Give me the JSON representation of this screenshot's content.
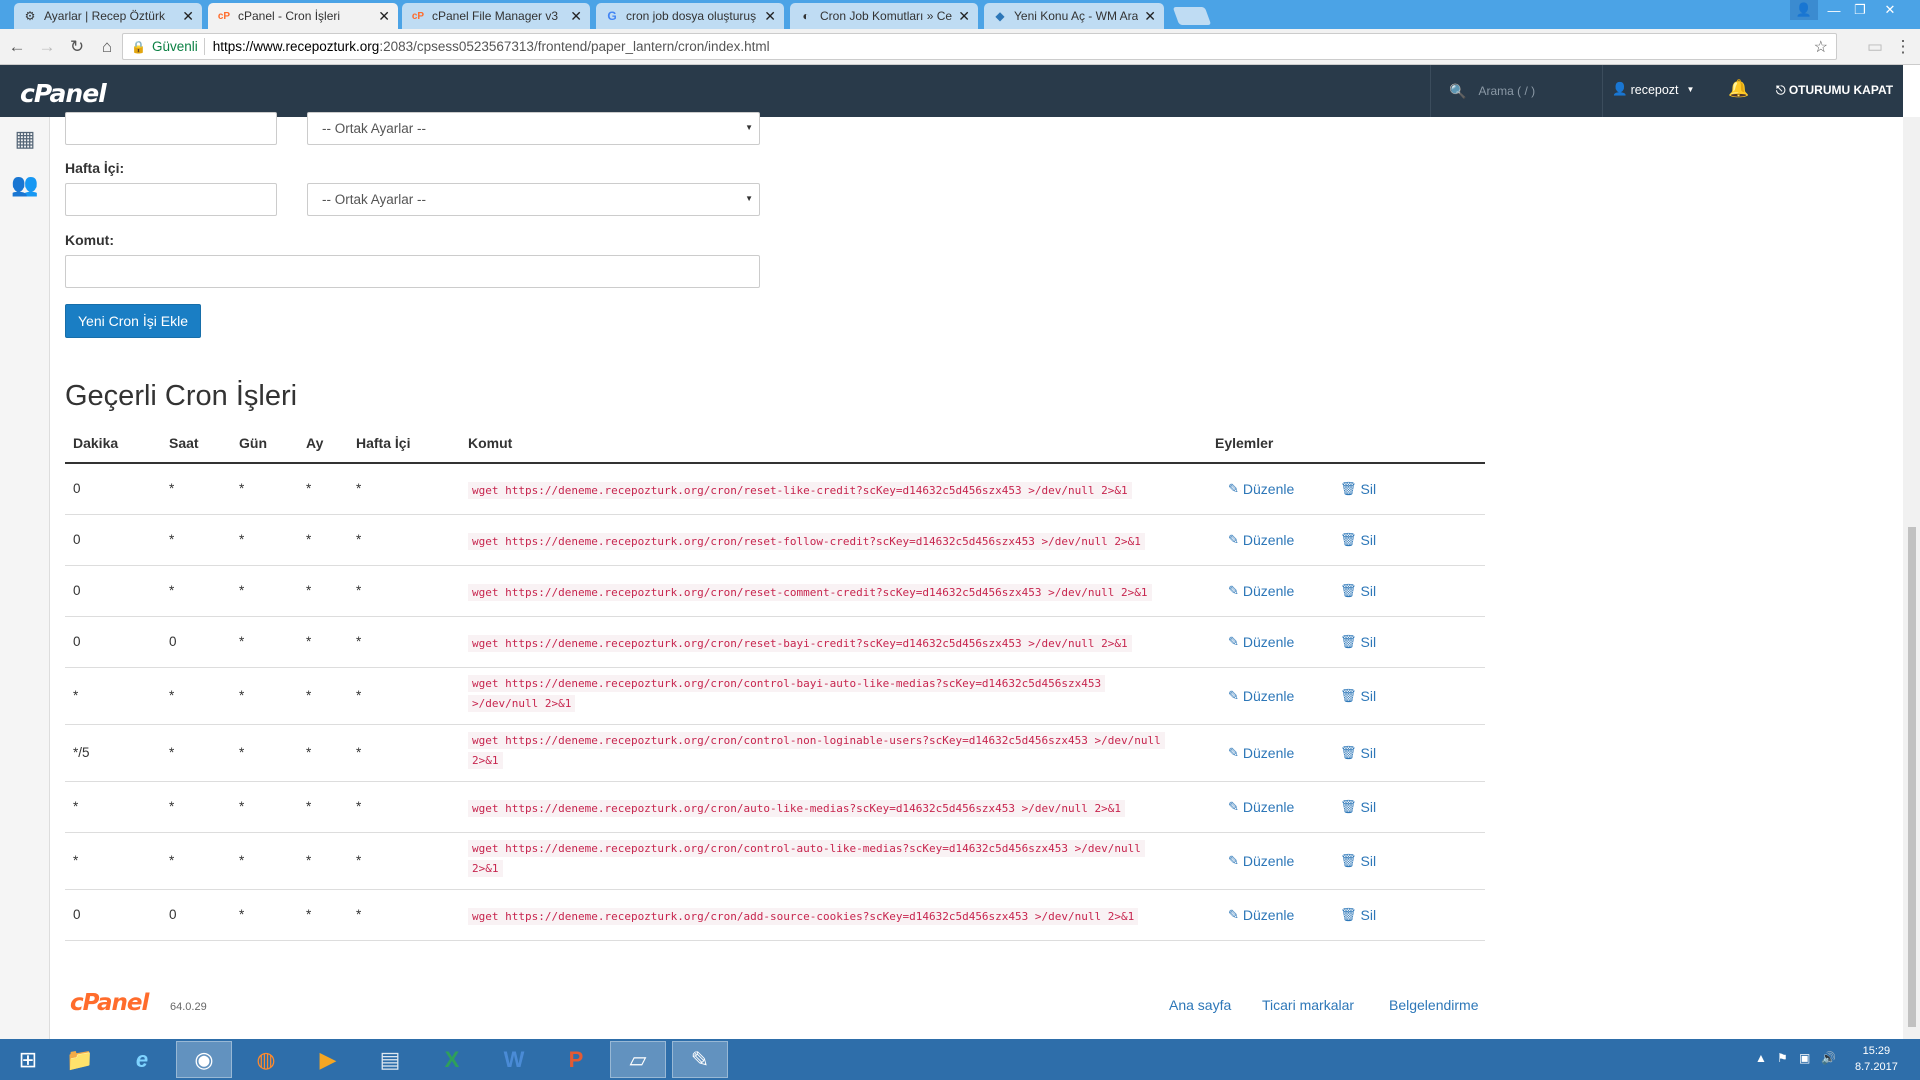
{
  "browser": {
    "tabs": [
      {
        "title": "Ayarlar | Recep Öztürk",
        "icon": "settings-favicon"
      },
      {
        "title": "cPanel - Cron İşleri",
        "icon": "cpanel-favicon"
      },
      {
        "title": "cPanel File Manager v3",
        "icon": "cpanel-favicon"
      },
      {
        "title": "cron job dosya oluşturuş",
        "icon": "google-favicon"
      },
      {
        "title": "Cron Job Komutları » Ce",
        "icon": "page-favicon"
      },
      {
        "title": "Yeni Konu Aç - WM Arac",
        "icon": "forum-favicon"
      }
    ],
    "secure_label": "Güvenli",
    "url_host": "https://www.recepozturk.org",
    "url_path": ":2083/cpsess0523567313/frontend/paper_lantern/cron/index.html"
  },
  "cpanel": {
    "logo": "cPanel",
    "search_placeholder": "Arama ( / )",
    "username": "recepozt",
    "logout_label": "OTURUMU KAPAT"
  },
  "form": {
    "top_select": "-- Ortak Ayarlar --",
    "weekday_label": "Hafta İçi:",
    "weekday_select": "-- Ortak Ayarlar --",
    "command_label": "Komut:",
    "add_button": "Yeni Cron İşi Ekle"
  },
  "table": {
    "title": "Geçerli Cron İşleri",
    "headers": [
      "Dakika",
      "Saat",
      "Gün",
      "Ay",
      "Hafta İçi",
      "Komut",
      "Eylemler"
    ],
    "edit_label": "Düzenle",
    "delete_label": "Sil",
    "rows": [
      {
        "minute": "0",
        "hour": "*",
        "day": "*",
        "month": "*",
        "weekday": "*",
        "cmd": [
          "wget https://deneme.recepozturk.org/cron/reset-like-credit?scKey=d14632c5d456szx453 >/dev/null 2>&1"
        ]
      },
      {
        "minute": "0",
        "hour": "*",
        "day": "*",
        "month": "*",
        "weekday": "*",
        "cmd": [
          "wget https://deneme.recepozturk.org/cron/reset-follow-credit?scKey=d14632c5d456szx453 >/dev/null 2>&1"
        ]
      },
      {
        "minute": "0",
        "hour": "*",
        "day": "*",
        "month": "*",
        "weekday": "*",
        "cmd": [
          "wget https://deneme.recepozturk.org/cron/reset-comment-credit?scKey=d14632c5d456szx453 >/dev/null 2>&1"
        ]
      },
      {
        "minute": "0",
        "hour": "0",
        "day": "*",
        "month": "*",
        "weekday": "*",
        "cmd": [
          "wget https://deneme.recepozturk.org/cron/reset-bayi-credit?scKey=d14632c5d456szx453 >/dev/null 2>&1"
        ]
      },
      {
        "minute": "*",
        "hour": "*",
        "day": "*",
        "month": "*",
        "weekday": "*",
        "cmd": [
          "wget https://deneme.recepozturk.org/cron/control-bayi-auto-like-medias?scKey=d14632c5d456szx453",
          ">/dev/null 2>&1"
        ]
      },
      {
        "minute": "*/5",
        "hour": "*",
        "day": "*",
        "month": "*",
        "weekday": "*",
        "cmd": [
          "wget https://deneme.recepozturk.org/cron/control-non-loginable-users?scKey=d14632c5d456szx453 >/dev/null",
          "2>&1"
        ]
      },
      {
        "minute": "*",
        "hour": "*",
        "day": "*",
        "month": "*",
        "weekday": "*",
        "cmd": [
          "wget https://deneme.recepozturk.org/cron/auto-like-medias?scKey=d14632c5d456szx453 >/dev/null 2>&1"
        ]
      },
      {
        "minute": "*",
        "hour": "*",
        "day": "*",
        "month": "*",
        "weekday": "*",
        "cmd": [
          "wget https://deneme.recepozturk.org/cron/control-auto-like-medias?scKey=d14632c5d456szx453 >/dev/null",
          "2>&1"
        ]
      },
      {
        "minute": "0",
        "hour": "0",
        "day": "*",
        "month": "*",
        "weekday": "*",
        "cmd": [
          "wget https://deneme.recepozturk.org/cron/add-source-cookies?scKey=d14632c5d456szx453 >/dev/null 2>&1"
        ]
      }
    ]
  },
  "footer": {
    "logo": "cPanel",
    "version": "64.0.29",
    "links": [
      "Ana sayfa",
      "Ticari markalar",
      "Belgelendirme"
    ]
  },
  "taskbar": {
    "apps": [
      "windows-start-icon",
      "file-explorer-icon",
      "internet-explorer-icon",
      "chrome-icon",
      "firefox-icon",
      "media-player-icon",
      "calculator-icon",
      "excel-icon",
      "word-icon",
      "powerpoint-icon",
      "notepad-icon",
      "paint-icon"
    ],
    "time": "15:29",
    "date": "8.7.2017"
  },
  "colors": {
    "cpanel_bar": "#293a4a",
    "accent": "#1a7ec4",
    "link": "#2d77b8",
    "code": "#c7254e",
    "cpanel_orange": "#ff6c2c"
  }
}
